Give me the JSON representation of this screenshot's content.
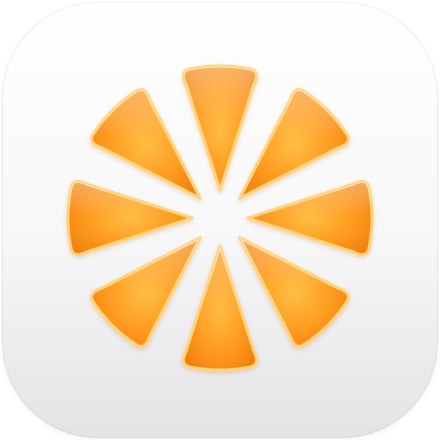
{
  "app_icon": {
    "icon_name": "orange-slice-icon",
    "segment_count": 8,
    "colors": {
      "background_top": "#ffffff",
      "background_bottom": "#ececee",
      "segment_light": "#ffc24a",
      "segment_mid": "#ff9a1f",
      "segment_dark": "#f07a0c",
      "segment_edge": "#ffd37a",
      "pith": "#ffffff"
    }
  }
}
